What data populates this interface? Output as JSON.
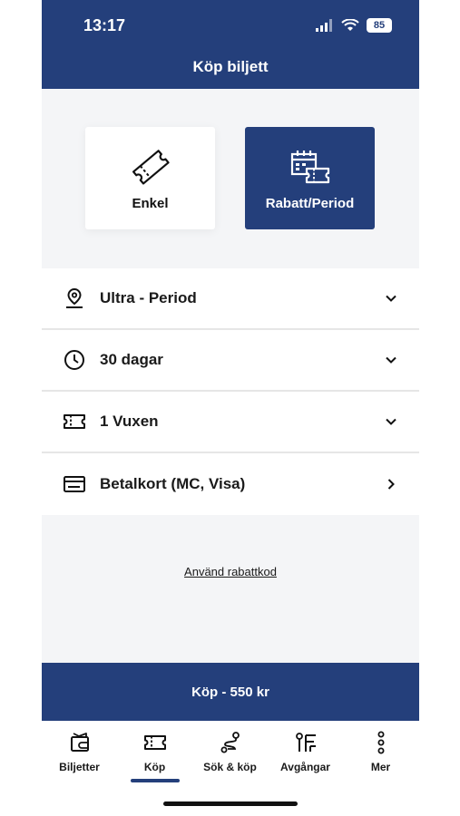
{
  "status_bar": {
    "time": "13:17",
    "battery": "85"
  },
  "header": {
    "title": "Köp biljett"
  },
  "ticket_types": [
    {
      "label": "Enkel",
      "icon": "ticket-icon",
      "selected": false
    },
    {
      "label": "Rabatt/Period",
      "icon": "calendar-ticket-icon",
      "selected": true
    }
  ],
  "options": [
    {
      "label": "Ultra - Period",
      "icon": "location-pin-icon",
      "action": "chevron-down-icon"
    },
    {
      "label": "30 dagar",
      "icon": "clock-icon",
      "action": "chevron-down-icon"
    },
    {
      "label": "1 Vuxen",
      "icon": "ticket-icon",
      "action": "chevron-down-icon"
    },
    {
      "label": "Betalkort (MC, Visa)",
      "icon": "card-icon",
      "action": "chevron-right-icon"
    }
  ],
  "discount_link": "Använd rabattkod",
  "buy_button": "Köp - 550 kr",
  "tabs": [
    {
      "label": "Biljetter",
      "icon": "tickets-icon",
      "active": false
    },
    {
      "label": "Köp",
      "icon": "buy-ticket-icon",
      "active": true
    },
    {
      "label": "Sök & köp",
      "icon": "route-icon",
      "active": false
    },
    {
      "label": "Avgångar",
      "icon": "departures-icon",
      "active": false
    },
    {
      "label": "Mer",
      "icon": "more-icon",
      "active": false
    }
  ],
  "colors": {
    "brand": "#243f7b",
    "background": "#f4f5f7",
    "divider": "#e6e6e6"
  }
}
